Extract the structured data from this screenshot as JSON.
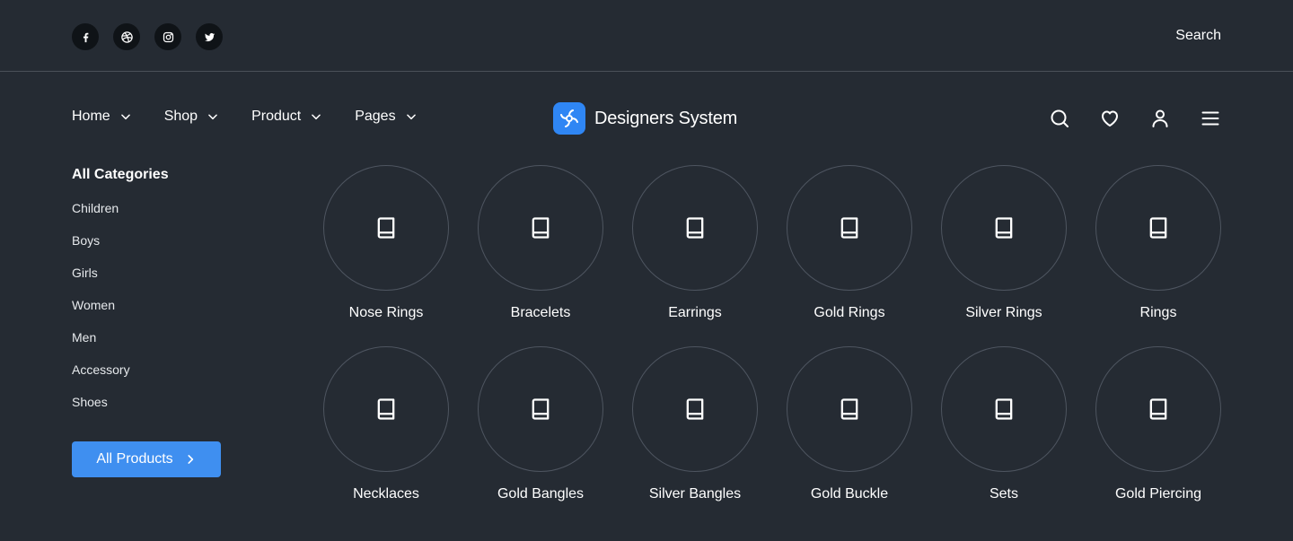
{
  "colors": {
    "background": "#252b33",
    "accent": "#3f8ff0",
    "logo_bg": "#2f86f4",
    "social_bg": "#0f1317",
    "circle_border": "#4e5560"
  },
  "topbar": {
    "socials": [
      {
        "icon": "facebook-icon"
      },
      {
        "icon": "dribbble-icon"
      },
      {
        "icon": "instagram-icon"
      },
      {
        "icon": "twitter-icon"
      }
    ],
    "search_label": "Search"
  },
  "nav": {
    "items": [
      {
        "label": "Home",
        "icon": "chevron-down-icon"
      },
      {
        "label": "Shop",
        "icon": "chevron-down-icon"
      },
      {
        "label": "Product",
        "icon": "chevron-down-icon"
      },
      {
        "label": "Pages",
        "icon": "chevron-down-icon"
      }
    ]
  },
  "brand": {
    "name": "Designers System",
    "icon": "logo-icon"
  },
  "actions": [
    {
      "icon": "search-icon"
    },
    {
      "icon": "heart-icon"
    },
    {
      "icon": "user-icon"
    },
    {
      "icon": "menu-icon"
    }
  ],
  "sidebar": {
    "title": "All Categories",
    "items": [
      "Children",
      "Boys",
      "Girls",
      "Women",
      "Men",
      "Accessory",
      "Shoes"
    ],
    "button_label": "All Products",
    "button_icon": "chevron-right-icon"
  },
  "categories": [
    {
      "label": "Nose Rings",
      "icon": "book-icon"
    },
    {
      "label": "Bracelets",
      "icon": "book-icon"
    },
    {
      "label": "Earrings",
      "icon": "book-icon"
    },
    {
      "label": "Gold Rings",
      "icon": "book-icon"
    },
    {
      "label": "Silver Rings",
      "icon": "book-icon"
    },
    {
      "label": "Rings",
      "icon": "book-icon"
    },
    {
      "label": "Necklaces",
      "icon": "book-icon"
    },
    {
      "label": "Gold Bangles",
      "icon": "book-icon"
    },
    {
      "label": "Silver Bangles",
      "icon": "book-icon"
    },
    {
      "label": "Gold Buckle",
      "icon": "book-icon"
    },
    {
      "label": "Sets",
      "icon": "book-icon"
    },
    {
      "label": "Gold Piercing",
      "icon": "book-icon"
    }
  ]
}
